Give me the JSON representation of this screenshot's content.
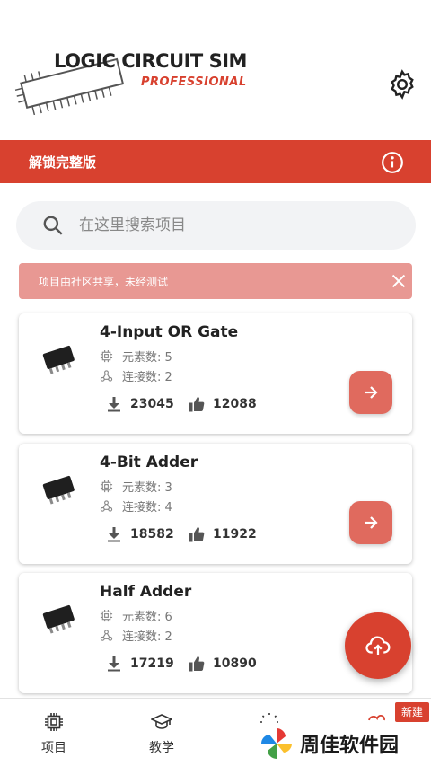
{
  "app": {
    "logo_title": "LOGIC CIRCUIT SIM",
    "logo_subtitle": "PROFESSIONAL"
  },
  "unlock_bar": {
    "label": "解锁完整版",
    "color": "#d8412f"
  },
  "search": {
    "placeholder": "在这里搜索项目"
  },
  "notice": {
    "text": "项目由社区共享，未经测试"
  },
  "projects": [
    {
      "title": "4-Input OR Gate",
      "elements": "元素数: 5",
      "connections": "连接数: 2",
      "downloads": "23045",
      "likes": "12088"
    },
    {
      "title": "4-Bit Adder",
      "elements": "元素数: 3",
      "connections": "连接数: 4",
      "downloads": "18582",
      "likes": "11922"
    },
    {
      "title": "Half Adder",
      "elements": "元素数: 6",
      "connections": "连接数: 2",
      "downloads": "17219",
      "likes": "10890"
    }
  ],
  "bottom_nav": {
    "items": [
      {
        "label": "项目",
        "icon": "chip-icon"
      },
      {
        "label": "教学",
        "icon": "graduation-cap-icon"
      },
      {
        "label": "",
        "icon": "lightbulb-icon"
      },
      {
        "label": "",
        "icon": "cloud-icon"
      }
    ],
    "new_badge": "新建"
  },
  "watermark": {
    "text": "周佳软件园"
  },
  "colors": {
    "accent": "#d8412f",
    "arrow_button": "#e06a5e",
    "notice": "#e89893"
  }
}
